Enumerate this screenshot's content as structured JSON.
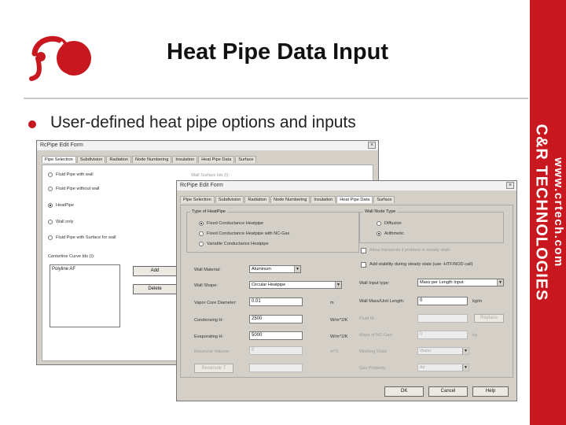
{
  "slide": {
    "title": "Heat Pipe Data Input",
    "bullet": "User-defined heat pipe options and inputs",
    "brand": "C&R TECHNOLOGIES",
    "url": "www.crtech.com"
  },
  "back_window": {
    "title": "RcPipe Edit Form",
    "tabs": [
      "Pipe Selection",
      "Subdivision",
      "Radiation",
      "Node Numbering",
      "Insulation",
      "Heat Pipe Data",
      "Surface"
    ],
    "options": [
      "Fluid Pipe with wall",
      "Fluid Pipe without wall",
      "HeatPipe",
      "Wall only",
      "Fluid Pipe with Surface for wall"
    ],
    "wall_surface_label": "Wall Surface Ids (I):",
    "centerline_label": "Centerline Curve Ids (I):",
    "centerline_value": "Polyline AF",
    "add_label": "Add",
    "delete_label": "Delete"
  },
  "front_window": {
    "title": "RcPipe Edit Form",
    "tabs": [
      "Pipe Selection",
      "Subdivision",
      "Radiation",
      "Node Numbering",
      "Insulation",
      "Heat Pipe Data",
      "Surface"
    ],
    "type_group": "Type of HeatPipe",
    "type_options": [
      "Fixed Conductance Heatpipe",
      "Fixed Conductance Heatpipe with NC-Gas",
      "Variable Conductance Heatpipe"
    ],
    "wall_node_group": "Wall Node Type",
    "wall_node_options": [
      "Diffusion",
      "Arithmetic"
    ],
    "check_transient": "Allow transients if problem is steady state",
    "check_stability": "Add stability during steady state (use -HTF/NOD call)",
    "wall_material_label": "Wall Material:",
    "wall_material_value": "Aluminum",
    "wall_input_label": "Wall Input type:",
    "wall_input_value": "Mass per Length Input",
    "wall_shape_label": "Wall Shape:",
    "wall_shape_value": "Circular Heatpipe",
    "wall_mass_label": "Wall Mass/Unit Length:",
    "wall_mass_value": "0",
    "wall_mass_unit": "kg/m",
    "vapor_label": "Vapor Core Diameter:",
    "vapor_value": "0.01",
    "vapor_unit": "m",
    "fluid_label": "Fluid Id:",
    "replace_label": "Replace",
    "cond_label": "Condensing H:",
    "cond_value": "2500",
    "cond_unit": "W/m^2/K",
    "ncgas_label": "Mass of NC-Gas:",
    "ncgas_value": "0",
    "ncgas_unit": "kg",
    "evap_label": "Evaporating H:",
    "evap_value": "5000",
    "evap_unit": "W/m^2/K",
    "working_label": "Working Fluid:",
    "working_value": "Water",
    "reservoir_label": "Reservoir Volume:",
    "reservoir_value": "0",
    "reservoir_unit": "m^3",
    "gas_label": "Gas Property:",
    "gas_value": "Air",
    "reservoir_t_label": "Reservoir T",
    "ok_label": "OK",
    "cancel_label": "Cancel",
    "help_label": "Help"
  },
  "colors": {
    "brand_red": "#c8171e",
    "dialog_gray": "#d4d0c8"
  }
}
